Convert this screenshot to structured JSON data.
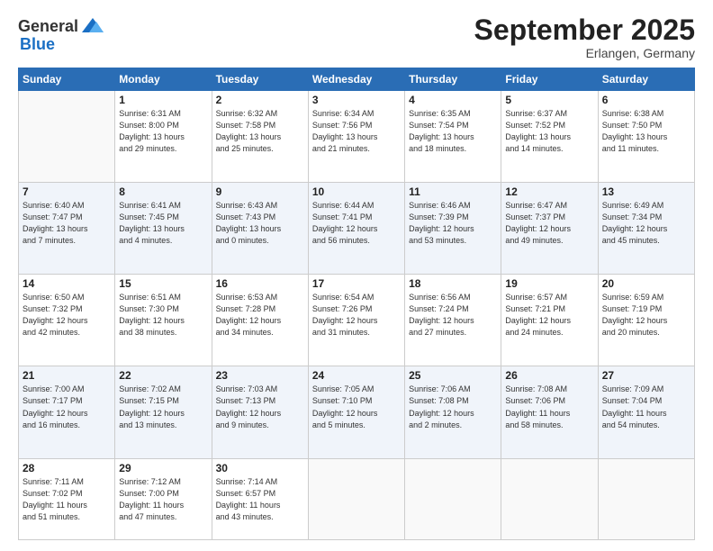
{
  "header": {
    "logo_general": "General",
    "logo_blue": "Blue",
    "month_title": "September 2025",
    "location": "Erlangen, Germany"
  },
  "calendar": {
    "days_of_week": [
      "Sunday",
      "Monday",
      "Tuesday",
      "Wednesday",
      "Thursday",
      "Friday",
      "Saturday"
    ],
    "weeks": [
      [
        {
          "day": "",
          "info": ""
        },
        {
          "day": "1",
          "info": "Sunrise: 6:31 AM\nSunset: 8:00 PM\nDaylight: 13 hours\nand 29 minutes."
        },
        {
          "day": "2",
          "info": "Sunrise: 6:32 AM\nSunset: 7:58 PM\nDaylight: 13 hours\nand 25 minutes."
        },
        {
          "day": "3",
          "info": "Sunrise: 6:34 AM\nSunset: 7:56 PM\nDaylight: 13 hours\nand 21 minutes."
        },
        {
          "day": "4",
          "info": "Sunrise: 6:35 AM\nSunset: 7:54 PM\nDaylight: 13 hours\nand 18 minutes."
        },
        {
          "day": "5",
          "info": "Sunrise: 6:37 AM\nSunset: 7:52 PM\nDaylight: 13 hours\nand 14 minutes."
        },
        {
          "day": "6",
          "info": "Sunrise: 6:38 AM\nSunset: 7:50 PM\nDaylight: 13 hours\nand 11 minutes."
        }
      ],
      [
        {
          "day": "7",
          "info": "Sunrise: 6:40 AM\nSunset: 7:47 PM\nDaylight: 13 hours\nand 7 minutes."
        },
        {
          "day": "8",
          "info": "Sunrise: 6:41 AM\nSunset: 7:45 PM\nDaylight: 13 hours\nand 4 minutes."
        },
        {
          "day": "9",
          "info": "Sunrise: 6:43 AM\nSunset: 7:43 PM\nDaylight: 13 hours\nand 0 minutes."
        },
        {
          "day": "10",
          "info": "Sunrise: 6:44 AM\nSunset: 7:41 PM\nDaylight: 12 hours\nand 56 minutes."
        },
        {
          "day": "11",
          "info": "Sunrise: 6:46 AM\nSunset: 7:39 PM\nDaylight: 12 hours\nand 53 minutes."
        },
        {
          "day": "12",
          "info": "Sunrise: 6:47 AM\nSunset: 7:37 PM\nDaylight: 12 hours\nand 49 minutes."
        },
        {
          "day": "13",
          "info": "Sunrise: 6:49 AM\nSunset: 7:34 PM\nDaylight: 12 hours\nand 45 minutes."
        }
      ],
      [
        {
          "day": "14",
          "info": "Sunrise: 6:50 AM\nSunset: 7:32 PM\nDaylight: 12 hours\nand 42 minutes."
        },
        {
          "day": "15",
          "info": "Sunrise: 6:51 AM\nSunset: 7:30 PM\nDaylight: 12 hours\nand 38 minutes."
        },
        {
          "day": "16",
          "info": "Sunrise: 6:53 AM\nSunset: 7:28 PM\nDaylight: 12 hours\nand 34 minutes."
        },
        {
          "day": "17",
          "info": "Sunrise: 6:54 AM\nSunset: 7:26 PM\nDaylight: 12 hours\nand 31 minutes."
        },
        {
          "day": "18",
          "info": "Sunrise: 6:56 AM\nSunset: 7:24 PM\nDaylight: 12 hours\nand 27 minutes."
        },
        {
          "day": "19",
          "info": "Sunrise: 6:57 AM\nSunset: 7:21 PM\nDaylight: 12 hours\nand 24 minutes."
        },
        {
          "day": "20",
          "info": "Sunrise: 6:59 AM\nSunset: 7:19 PM\nDaylight: 12 hours\nand 20 minutes."
        }
      ],
      [
        {
          "day": "21",
          "info": "Sunrise: 7:00 AM\nSunset: 7:17 PM\nDaylight: 12 hours\nand 16 minutes."
        },
        {
          "day": "22",
          "info": "Sunrise: 7:02 AM\nSunset: 7:15 PM\nDaylight: 12 hours\nand 13 minutes."
        },
        {
          "day": "23",
          "info": "Sunrise: 7:03 AM\nSunset: 7:13 PM\nDaylight: 12 hours\nand 9 minutes."
        },
        {
          "day": "24",
          "info": "Sunrise: 7:05 AM\nSunset: 7:10 PM\nDaylight: 12 hours\nand 5 minutes."
        },
        {
          "day": "25",
          "info": "Sunrise: 7:06 AM\nSunset: 7:08 PM\nDaylight: 12 hours\nand 2 minutes."
        },
        {
          "day": "26",
          "info": "Sunrise: 7:08 AM\nSunset: 7:06 PM\nDaylight: 11 hours\nand 58 minutes."
        },
        {
          "day": "27",
          "info": "Sunrise: 7:09 AM\nSunset: 7:04 PM\nDaylight: 11 hours\nand 54 minutes."
        }
      ],
      [
        {
          "day": "28",
          "info": "Sunrise: 7:11 AM\nSunset: 7:02 PM\nDaylight: 11 hours\nand 51 minutes."
        },
        {
          "day": "29",
          "info": "Sunrise: 7:12 AM\nSunset: 7:00 PM\nDaylight: 11 hours\nand 47 minutes."
        },
        {
          "day": "30",
          "info": "Sunrise: 7:14 AM\nSunset: 6:57 PM\nDaylight: 11 hours\nand 43 minutes."
        },
        {
          "day": "",
          "info": ""
        },
        {
          "day": "",
          "info": ""
        },
        {
          "day": "",
          "info": ""
        },
        {
          "day": "",
          "info": ""
        }
      ]
    ]
  }
}
